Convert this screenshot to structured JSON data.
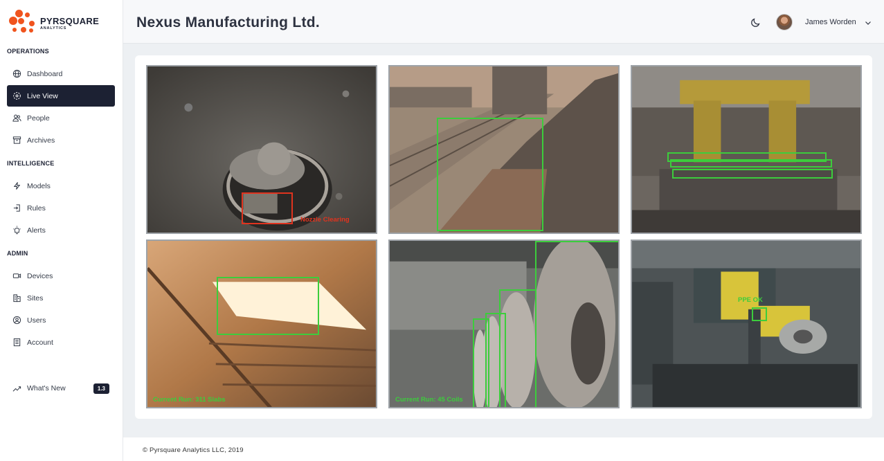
{
  "brand": {
    "name": "PYRSQUARE",
    "sub": "ANALYTICS",
    "accent": "#f0541e"
  },
  "sidebar": {
    "sections": [
      {
        "title": "OPERATIONS"
      },
      {
        "title": "INTELLIGENCE"
      },
      {
        "title": "ADMIN"
      }
    ],
    "items": [
      {
        "label": "Dashboard",
        "icon": "globe-icon"
      },
      {
        "label": "Live View",
        "icon": "live-icon",
        "active": true
      },
      {
        "label": "People",
        "icon": "people-icon"
      },
      {
        "label": "Archives",
        "icon": "archive-icon"
      },
      {
        "label": "Models",
        "icon": "bolt-icon"
      },
      {
        "label": "Rules",
        "icon": "enter-icon"
      },
      {
        "label": "Alerts",
        "icon": "alert-bulb-icon"
      },
      {
        "label": "Devices",
        "icon": "video-icon"
      },
      {
        "label": "Sites",
        "icon": "building-icon"
      },
      {
        "label": "Users",
        "icon": "user-circle-icon"
      },
      {
        "label": "Account",
        "icon": "office-icon"
      }
    ],
    "whats_new": {
      "label": "What's New",
      "badge": "1.3",
      "icon": "trending-icon"
    }
  },
  "header": {
    "title": "Nexus Manufacturing Ltd.",
    "user_name": "James Worden",
    "theme_icon": "moon-icon"
  },
  "feeds": [
    {
      "label": "Nozzle Clearing",
      "label_color": "#e0331e"
    },
    {
      "label": ""
    },
    {
      "label": ""
    },
    {
      "label": "Current Run: 311 Slabs",
      "label_color": "#3ccd3c"
    },
    {
      "label": "Current Run: 45 Coils",
      "label_color": "#3ccd3c"
    },
    {
      "label": "PPE OK",
      "label_color": "#3ccd3c"
    }
  ],
  "footer": {
    "copyright": "© Pyrsquare Analytics LLC, 2019"
  }
}
